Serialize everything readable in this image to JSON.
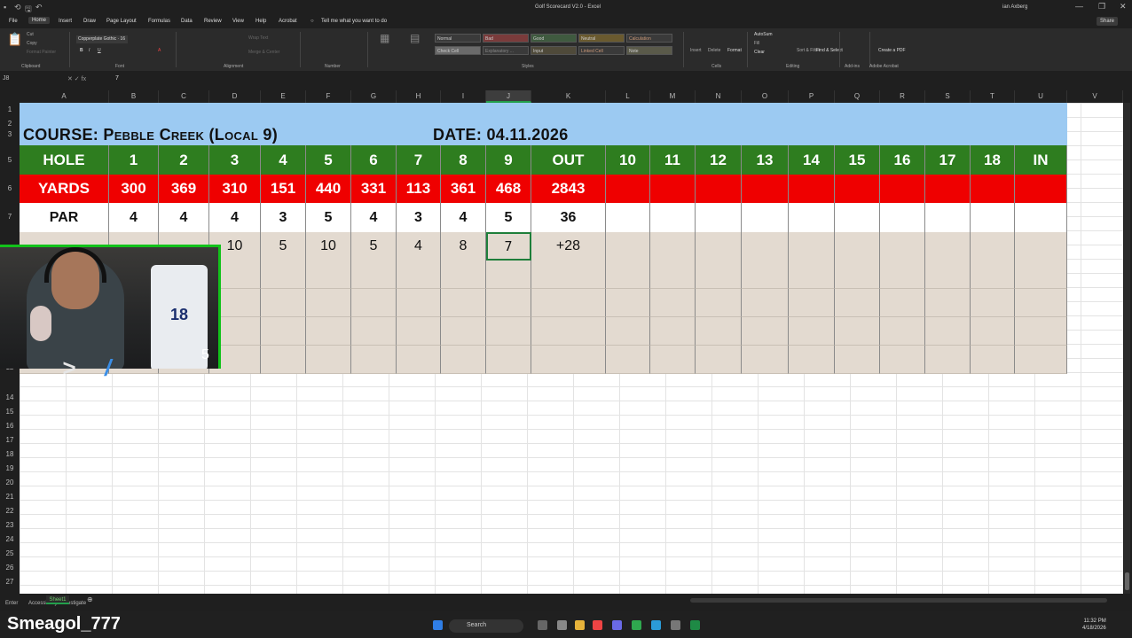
{
  "window": {
    "title": "Golf Scorecard V2.0 - Excel",
    "user": "ian Axberg"
  },
  "menu": {
    "tabs": [
      "File",
      "Home",
      "Insert",
      "Draw",
      "Page Layout",
      "Formulas",
      "Data",
      "Review",
      "View",
      "Help",
      "Acrobat"
    ],
    "tell_me": "Tell me what you want to do",
    "share": "Share"
  },
  "ribbon": {
    "font_name": "Copperplate Gothic",
    "font_size": "16",
    "groups": [
      "Clipboard",
      "Font",
      "Alignment",
      "Number",
      "Styles",
      "Cells",
      "Editing",
      "Add-ins",
      "Adobe Acrobat"
    ],
    "clipboard": [
      "Cut",
      "Copy",
      "Format Painter"
    ],
    "styles": [
      "Normal",
      "Bad",
      "Good",
      "Neutral",
      "Calculation",
      "Check Cell",
      "Explanatory ...",
      "Input",
      "Linked Cell",
      "Note"
    ],
    "cells": [
      "Insert",
      "Delete",
      "Format"
    ],
    "editing": [
      "AutoSum",
      "Fill",
      "Clear",
      "Sort & Filter",
      "Find & Select"
    ],
    "create_pdf": "Create a PDF"
  },
  "formula_bar": {
    "name_box": "J8",
    "value": "7"
  },
  "columns": [
    "A",
    "B",
    "C",
    "D",
    "E",
    "F",
    "G",
    "H",
    "I",
    "J",
    "K",
    "L",
    "M",
    "N",
    "O",
    "P",
    "Q",
    "R",
    "S",
    "T",
    "U",
    "V"
  ],
  "rows": [
    "1",
    "2",
    "3",
    "5",
    "6",
    "7",
    "12",
    "14",
    "15",
    "16",
    "17",
    "18",
    "19",
    "20",
    "21",
    "22",
    "23",
    "24",
    "25",
    "26",
    "27"
  ],
  "scorecard": {
    "course_label": "COURSE: Pebble Creek (Local 9)",
    "date_label": "DATE: 04.11.2026",
    "hole_row": [
      "HOLE",
      "1",
      "2",
      "3",
      "4",
      "5",
      "6",
      "7",
      "8",
      "9",
      "OUT",
      "10",
      "11",
      "12",
      "13",
      "14",
      "15",
      "16",
      "17",
      "18",
      "IN"
    ],
    "yards_row": [
      "YARDS",
      "300",
      "369",
      "310",
      "151",
      "440",
      "331",
      "113",
      "361",
      "468",
      "2843",
      "",
      "",
      "",
      "",
      "",
      "",
      "",
      "",
      "",
      ""
    ],
    "par_row": [
      "PAR",
      "4",
      "4",
      "4",
      "3",
      "5",
      "4",
      "3",
      "4",
      "5",
      "36",
      "",
      "",
      "",
      "",
      "",
      "",
      "",
      "",
      "",
      ""
    ],
    "score_row": [
      "",
      "",
      "",
      "10",
      "5",
      "10",
      "5",
      "4",
      "8",
      "7",
      "+28",
      "",
      "",
      "",
      "",
      "",
      "",
      "",
      "",
      "",
      ""
    ]
  },
  "webcam": {
    "counter": "5",
    "jersey_number": "18"
  },
  "status": {
    "ready": "Enter",
    "accessibility": "Accessibility: Investigate",
    "sheet": "Sheet1"
  },
  "taskbar": {
    "streamer": "Smeagol_777",
    "search": "Search",
    "time": "11:32 PM",
    "date": "4/18/2026"
  }
}
